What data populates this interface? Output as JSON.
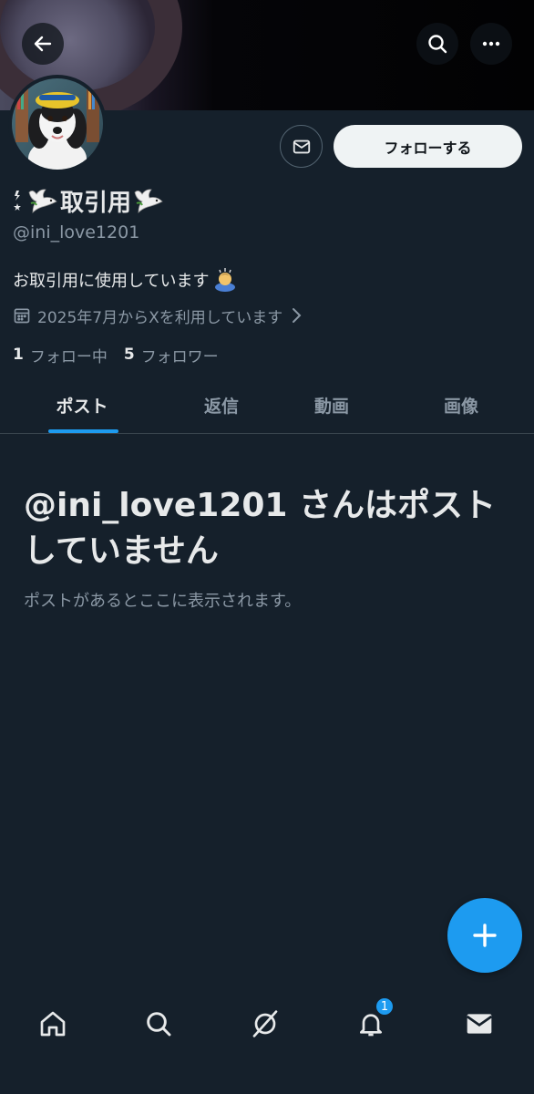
{
  "header": {
    "back_icon": "arrow-left-icon",
    "search_icon": "search-icon",
    "more_icon": "ellipsis-icon"
  },
  "profile": {
    "display_name": "取引用",
    "handle": "@ini_love1201",
    "bio": "お取引用に使用しています",
    "joined": "2025年7月からXを利用しています",
    "following_count": "1",
    "following_label": "フォロー中",
    "followers_count": "5",
    "followers_label": "フォロワー",
    "follow_button": "フォローする"
  },
  "tabs": [
    {
      "label": "ポスト",
      "active": true
    },
    {
      "label": "返信",
      "active": false
    },
    {
      "label": "動画",
      "active": false
    },
    {
      "label": "画像",
      "active": false
    }
  ],
  "empty_state": {
    "title": "@ini_love1201 さんはポストしていません",
    "subtitle": "ポストがあるとここに表示されます。"
  },
  "bottom_nav": {
    "items": [
      "home-icon",
      "search-icon",
      "grok-icon",
      "bell-icon",
      "mail-icon"
    ],
    "notification_badge": "1"
  },
  "colors": {
    "background": "#15202b",
    "accent": "#1d9bf0",
    "secondary_text": "#8b98a5"
  }
}
